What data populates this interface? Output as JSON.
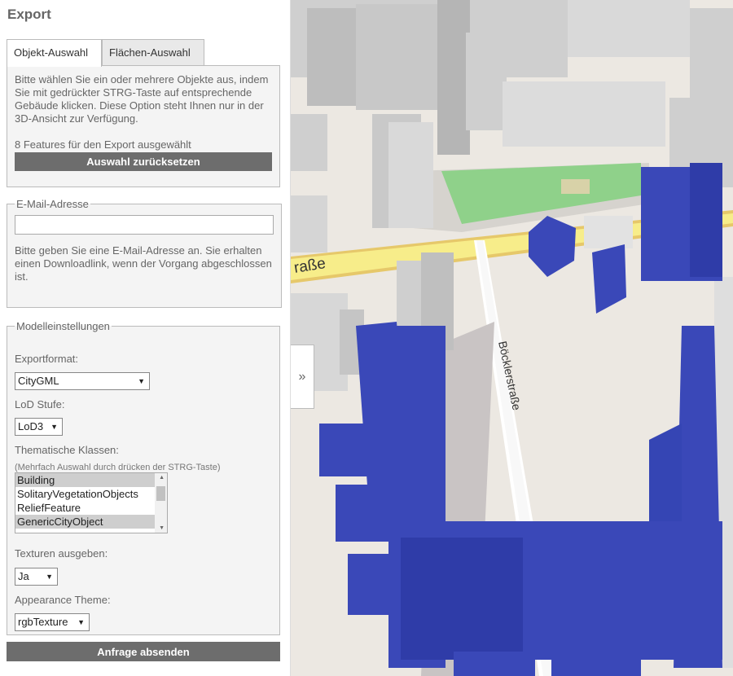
{
  "panel": {
    "title": "Export",
    "tabs": [
      {
        "label": "Objekt-Auswahl",
        "active": true
      },
      {
        "label": "Flächen-Auswahl",
        "active": false
      }
    ],
    "object_selection": {
      "instructions": "Bitte wählen Sie ein oder mehrere Objekte aus, indem Sie mit gedrückter STRG-Taste auf entsprechende Gebäude klicken. Diese Option steht Ihnen nur in der 3D-Ansicht zur Verfügung.",
      "selected_count_text": "8 Features für den Export ausgewählt",
      "reset_button": "Auswahl zurücksetzen"
    },
    "email": {
      "legend": "E-Mail-Adresse",
      "value": "",
      "hint": "Bitte geben Sie eine E-Mail-Adresse an. Sie erhalten einen Downloadlink, wenn der Vorgang abgeschlossen ist."
    },
    "model_settings": {
      "legend": "Modelleinstellungen",
      "export_format_label": "Exportformat:",
      "export_format_value": "CityGML",
      "lod_label": "LoD Stufe:",
      "lod_value": "LoD3",
      "classes_label": "Thematische Klassen:",
      "classes_note": "(Mehrfach Auswahl durch drücken der STRG-Taste)",
      "classes": [
        {
          "label": "Building",
          "selected": true
        },
        {
          "label": "SolitaryVegetationObjects",
          "selected": false
        },
        {
          "label": "ReliefFeature",
          "selected": false
        },
        {
          "label": "GenericCityObject",
          "selected": true
        }
      ],
      "textures_label": "Texturen ausgeben:",
      "textures_value": "Ja",
      "appearance_label": "Appearance Theme:",
      "appearance_value": "rgbTexture"
    },
    "submit_button": "Anfrage absenden"
  },
  "map": {
    "street_labels": [
      "raße",
      "Böcklerstraße"
    ],
    "collapse_icon": "double-chevron-right-icon",
    "colors": {
      "selected_building": "#3a48b8",
      "building": "#d4d4d4",
      "road": "#f7ed8a",
      "park": "#8fd18a",
      "ground": "#ece8e2"
    }
  }
}
